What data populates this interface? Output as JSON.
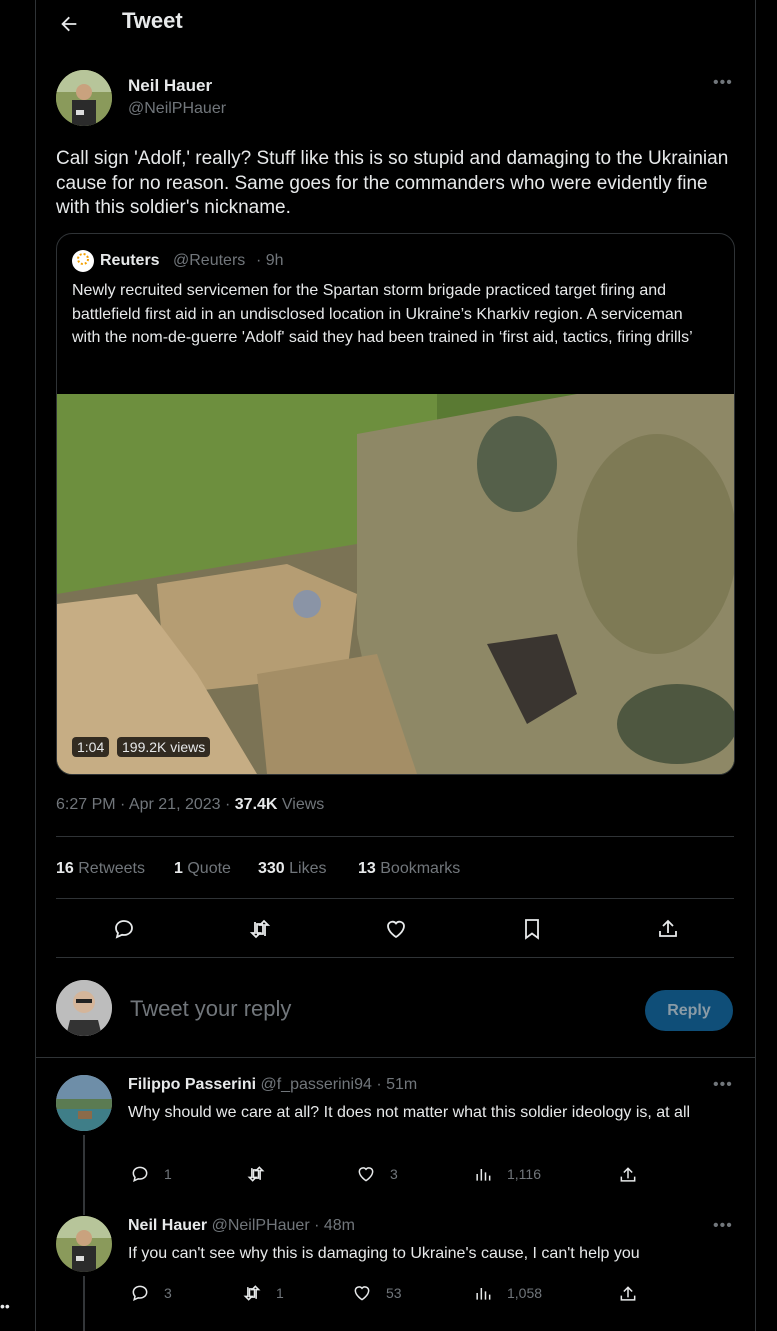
{
  "header": {
    "title": "Tweet"
  },
  "tweet": {
    "author_name": "Neil Hauer",
    "author_handle": "@NeilPHauer",
    "text": "Call sign 'Adolf,' really? Stuff like this is so stupid and damaging to the Ukrainian cause for no reason. Same goes for the commanders who were evidently fine with this soldier's nickname.",
    "quote": {
      "name": "Reuters",
      "handle": "@Reuters",
      "time": "· 9h",
      "text": "Newly recruited servicemen for the Spartan storm brigade practiced target firing and battlefield first aid in an undisclosed location in Ukraine’s Kharkiv region. A serviceman with the nom-de-guerre 'Adolf' said they had been trained in ‘first aid, tactics, firing drills’",
      "video_duration": "1:04",
      "video_views": "199.2K views"
    },
    "timestamp": "6:27 PM · Apr 21, 2023 · ",
    "views_count": "37.4K",
    "views_label": " Views",
    "stats": {
      "retweets": "16",
      "retweets_label": " Retweets",
      "quotes": "1",
      "quotes_label": " Quote",
      "likes": "330",
      "likes_label": " Likes",
      "bookmarks": "13",
      "bookmarks_label": " Bookmarks"
    }
  },
  "compose": {
    "placeholder": "Tweet your reply",
    "button": "Reply"
  },
  "replies": [
    {
      "name": "Filippo Passerini",
      "handle": "@f_passerini94",
      "time": "· 51m",
      "text": "Why should we care at all? It does not matter what this soldier ideology is, at all",
      "replies": "1",
      "retweets": "",
      "likes": "3",
      "views": "1,116"
    },
    {
      "name": "Neil Hauer",
      "handle": "@NeilPHauer",
      "time": "· 48m",
      "text": "If you can't see why this is damaging to Ukraine's cause, I can't help you",
      "replies": "3",
      "retweets": "1",
      "likes": "53",
      "views": "1,058"
    }
  ],
  "colors": {
    "background": "#000000",
    "accent": "#1d9bf0",
    "reply_button": "#0f4e78",
    "border": "#2f3336",
    "muted": "#71767b"
  }
}
